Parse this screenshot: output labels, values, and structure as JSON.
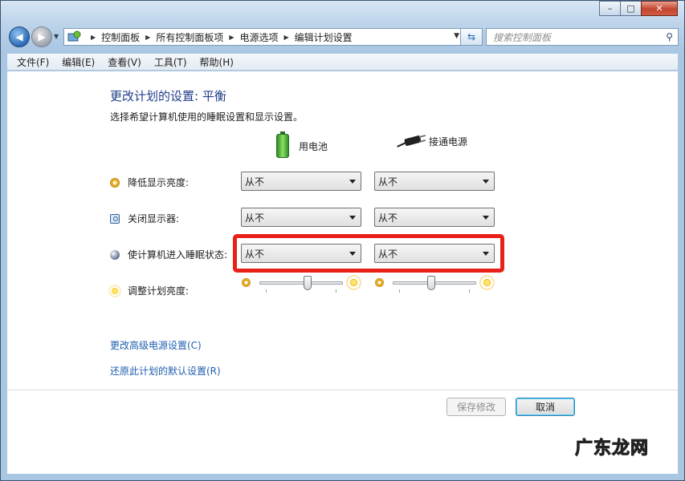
{
  "window": {
    "minimize_glyph": "–",
    "maximize_glyph": "□",
    "close_glyph": "✕"
  },
  "address": {
    "crumbs": [
      "控制面板",
      "所有控制面板项",
      "电源选项",
      "编辑计划设置"
    ],
    "search_placeholder": "搜索控制面板"
  },
  "menu": [
    "文件(F)",
    "编辑(E)",
    "查看(V)",
    "工具(T)",
    "帮助(H)"
  ],
  "page": {
    "title": "更改计划的设置: 平衡",
    "subtitle": "选择希望计算机使用的睡眠设置和显示设置。"
  },
  "columns": {
    "battery": "用电池",
    "plugged": "接通电源"
  },
  "settings": [
    {
      "label": "降低显示亮度:",
      "battery": "从不",
      "plugged": "从不",
      "icon": "dim-display-icon"
    },
    {
      "label": "关闭显示器:",
      "battery": "从不",
      "plugged": "从不",
      "icon": "monitor-icon"
    },
    {
      "label": "使计算机进入睡眠状态:",
      "battery": "从不",
      "plugged": "从不",
      "icon": "sleep-moon-icon"
    }
  ],
  "brightness": {
    "label": "调整计划亮度:",
    "battery_level_percent": 58,
    "plugged_level_percent": 46
  },
  "links": {
    "advanced": "更改高级电源设置(C)",
    "restore": "还原此计划的默认设置(R)"
  },
  "buttons": {
    "save": "保存修改",
    "cancel": "取消"
  },
  "watermark": "广东龙网",
  "colors": {
    "highlight": "#e8201a",
    "link": "#1f5fb0",
    "title": "#1e3d8a"
  }
}
